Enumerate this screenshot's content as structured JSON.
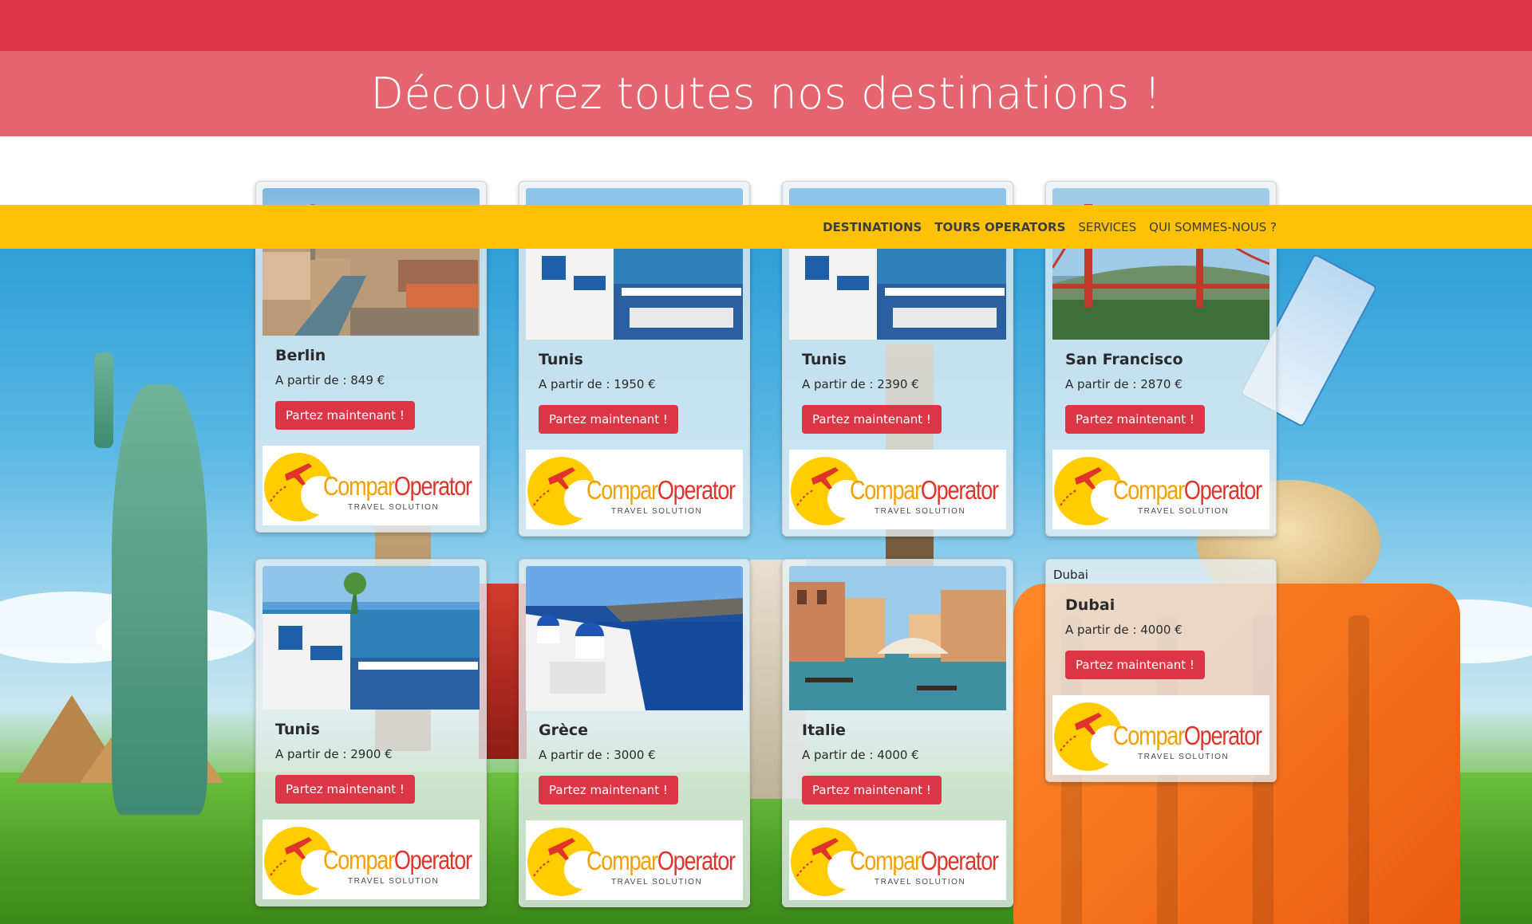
{
  "hero": {
    "title": "Découvrez toutes nos destinations !"
  },
  "nav": {
    "items": [
      {
        "label": "DESTINATIONS",
        "bold": true
      },
      {
        "label": "TOURS OPERATORS",
        "bold": true
      },
      {
        "label": "SERVICES",
        "bold": false
      },
      {
        "label": "QUI SOMMES-NOUS ?",
        "bold": false
      }
    ]
  },
  "button_label": "Partez maintenant !",
  "logo": {
    "brand_part1": "Compar",
    "brand_part2": "Operator",
    "tagline": "TRAVEL SOLUTION"
  },
  "cards": [
    {
      "title": "Berlin",
      "price": "A partir de : 849 €",
      "image": "berlin-city"
    },
    {
      "title": "Tunis",
      "price": "A partir de : 1950 €",
      "image": "tunis-harbor"
    },
    {
      "title": "Tunis",
      "price": "A partir de : 2390 €",
      "image": "tunis-harbor"
    },
    {
      "title": "San Francisco",
      "price": "A partir de : 2870 €",
      "image": "golden-gate"
    },
    {
      "title": "Tunis",
      "price": "A partir de : 2900 €",
      "image": "tunis-harbor"
    },
    {
      "title": "Grèce",
      "price": "A partir de : 3000 €",
      "image": "santorini"
    },
    {
      "title": "Italie",
      "price": "A partir de : 4000 €",
      "image": "venice"
    },
    {
      "title": "Dubai",
      "price": "A partir de : 4000 €",
      "image": "missing",
      "alt_text": "Dubai"
    }
  ],
  "colors": {
    "primary_red": "#dc3545",
    "hero_band": "#e4646f",
    "navbar_yellow": "#ffc107"
  }
}
